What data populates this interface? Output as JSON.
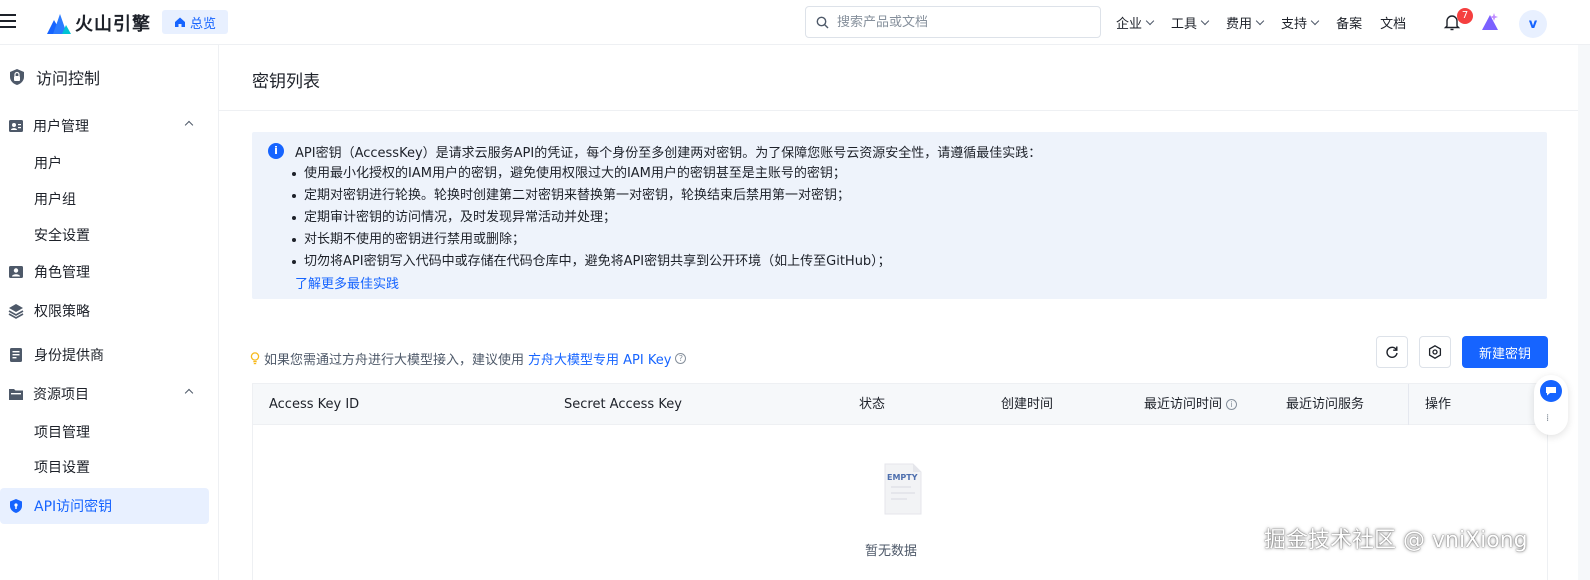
{
  "topbar": {
    "brand": "火山引擎",
    "home_label": "总览",
    "search_placeholder": "搜索产品或文档",
    "nav": [
      {
        "label": "企业",
        "has_menu": true
      },
      {
        "label": "工具",
        "has_menu": true
      },
      {
        "label": "费用",
        "has_menu": true
      },
      {
        "label": "支持",
        "has_menu": true
      },
      {
        "label": "备案",
        "has_menu": false
      },
      {
        "label": "文档",
        "has_menu": false
      }
    ],
    "notification_count": "7",
    "avatar_letter": "v"
  },
  "sidebar": {
    "title": "访问控制",
    "items": [
      {
        "label": "用户管理",
        "type": "group",
        "icon": "user-card-icon",
        "expanded": true
      },
      {
        "label": "用户",
        "type": "sub"
      },
      {
        "label": "用户组",
        "type": "sub"
      },
      {
        "label": "安全设置",
        "type": "sub"
      },
      {
        "label": "角色管理",
        "type": "item",
        "icon": "role-icon"
      },
      {
        "label": "权限策略",
        "type": "item",
        "icon": "layers-icon"
      },
      {
        "label": "身份提供商",
        "type": "item",
        "icon": "id-icon"
      },
      {
        "label": "资源项目",
        "type": "group",
        "icon": "folder-icon",
        "expanded": true
      },
      {
        "label": "项目管理",
        "type": "sub"
      },
      {
        "label": "项目设置",
        "type": "sub"
      },
      {
        "label": "API访问密钥",
        "type": "item",
        "icon": "shield-icon",
        "active": true
      }
    ]
  },
  "main": {
    "page_title": "密钥列表",
    "info": {
      "headline": "API密钥（AccessKey）是请求云服务API的凭证，每个身份至多创建两对密钥。为了保障您账号云资源安全性，请遵循最佳实践：",
      "bullets": [
        "使用最小化授权的IAM用户的密钥，避免使用权限过大的IAM用户的密钥甚至是主账号的密钥；",
        "定期对密钥进行轮换。轮换时创建第二对密钥来替换第一对密钥，轮换结束后禁用第一对密钥；",
        "定期审计密钥的访问情况，及时发现异常活动并处理；",
        "对长期不使用的密钥进行禁用或删除；",
        "切勿将API密钥写入代码中或存储在代码仓库中，避免将API密钥共享到公开环境（如上传至GitHub）；"
      ],
      "link": "了解更多最佳实践"
    },
    "tip": {
      "prefix": "如果您需通过方舟进行大模型接入，建议使用",
      "link": "方舟大模型专用 API Key"
    },
    "create_button": "新建密钥",
    "table": {
      "columns": [
        "Access Key ID",
        "Secret Access Key",
        "状态",
        "创建时间",
        "最近访问时间",
        "最近访问服务",
        "操作"
      ],
      "rows": [],
      "empty_badge": "EMPTY",
      "empty_text": "暂无数据"
    }
  },
  "watermark": "掘金技术社区 @ vniXiong",
  "colors": {
    "accent": "#1664ff",
    "info_bg": "#eef3fb",
    "badge": "#f53f3f"
  }
}
